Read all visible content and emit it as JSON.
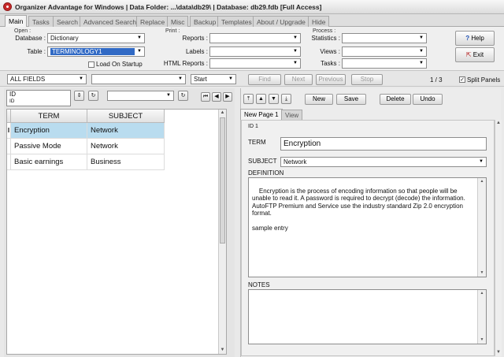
{
  "window": {
    "title": "Organizer Advantage for Windows | Data Folder: ...\\data\\db29\\ | Database: db29.fdb [Full Access]"
  },
  "tabs": [
    "Main",
    "Tasks",
    "Search",
    "Advanced Search",
    "Replace",
    "Misc",
    "Backup",
    "Templates",
    "About / Upgrade",
    "Hide"
  ],
  "open_group": {
    "caption": "Open :",
    "database_label": "Database :",
    "database_value": "Dictionary",
    "table_label": "Table :",
    "table_value": "TERMINOLOGY1",
    "load_on_startup": "Load On Startup"
  },
  "print_group": {
    "caption": "Print :",
    "reports_label": "Reports :",
    "labels_label": "Labels :",
    "html_reports_label": "HTML Reports :"
  },
  "process_group": {
    "caption": "Process :",
    "statistics_label": "Statistics :",
    "views_label": "Views :",
    "tasks_label": "Tasks :"
  },
  "help_button": "Help",
  "exit_button": "Exit",
  "search_bar": {
    "field_select": "ALL FIELDS",
    "search_text": "",
    "mode_select": "Start",
    "find": "Find",
    "next": "Next",
    "previous": "Previous",
    "stop": "Stop",
    "record_counter": "1 / 3",
    "split_panels": "Split Panels"
  },
  "sort_bar": {
    "sort_field": "ID",
    "sort_field_sub": "ID"
  },
  "grid": {
    "columns": [
      "TERM",
      "SUBJECT"
    ],
    "rows": [
      {
        "term": "Encryption",
        "subject": "Network",
        "current": "I"
      },
      {
        "term": "Passive Mode",
        "subject": "Network",
        "current": ""
      },
      {
        "term": "Basic earnings",
        "subject": "Business",
        "current": ""
      }
    ]
  },
  "record_toolbar": {
    "new": "New",
    "save": "Save",
    "delete": "Delete",
    "undo": "Undo"
  },
  "page_tabs": [
    "New Page 1",
    "View"
  ],
  "record": {
    "id_label": "ID 1",
    "term_label": "TERM",
    "term_value": "Encryption",
    "subject_label": "SUBJECT",
    "subject_value": "Network",
    "definition_label": "DEFINITION",
    "definition_value": "Encryption is the process of encoding information so that people will be unable to read it. A password is required to decrypt (decode) the information. AutoFTP Premium and Service use the industry standard Zip 2.0 encryption format.\n\nsample entry",
    "notes_label": "NOTES",
    "notes_value": ""
  }
}
